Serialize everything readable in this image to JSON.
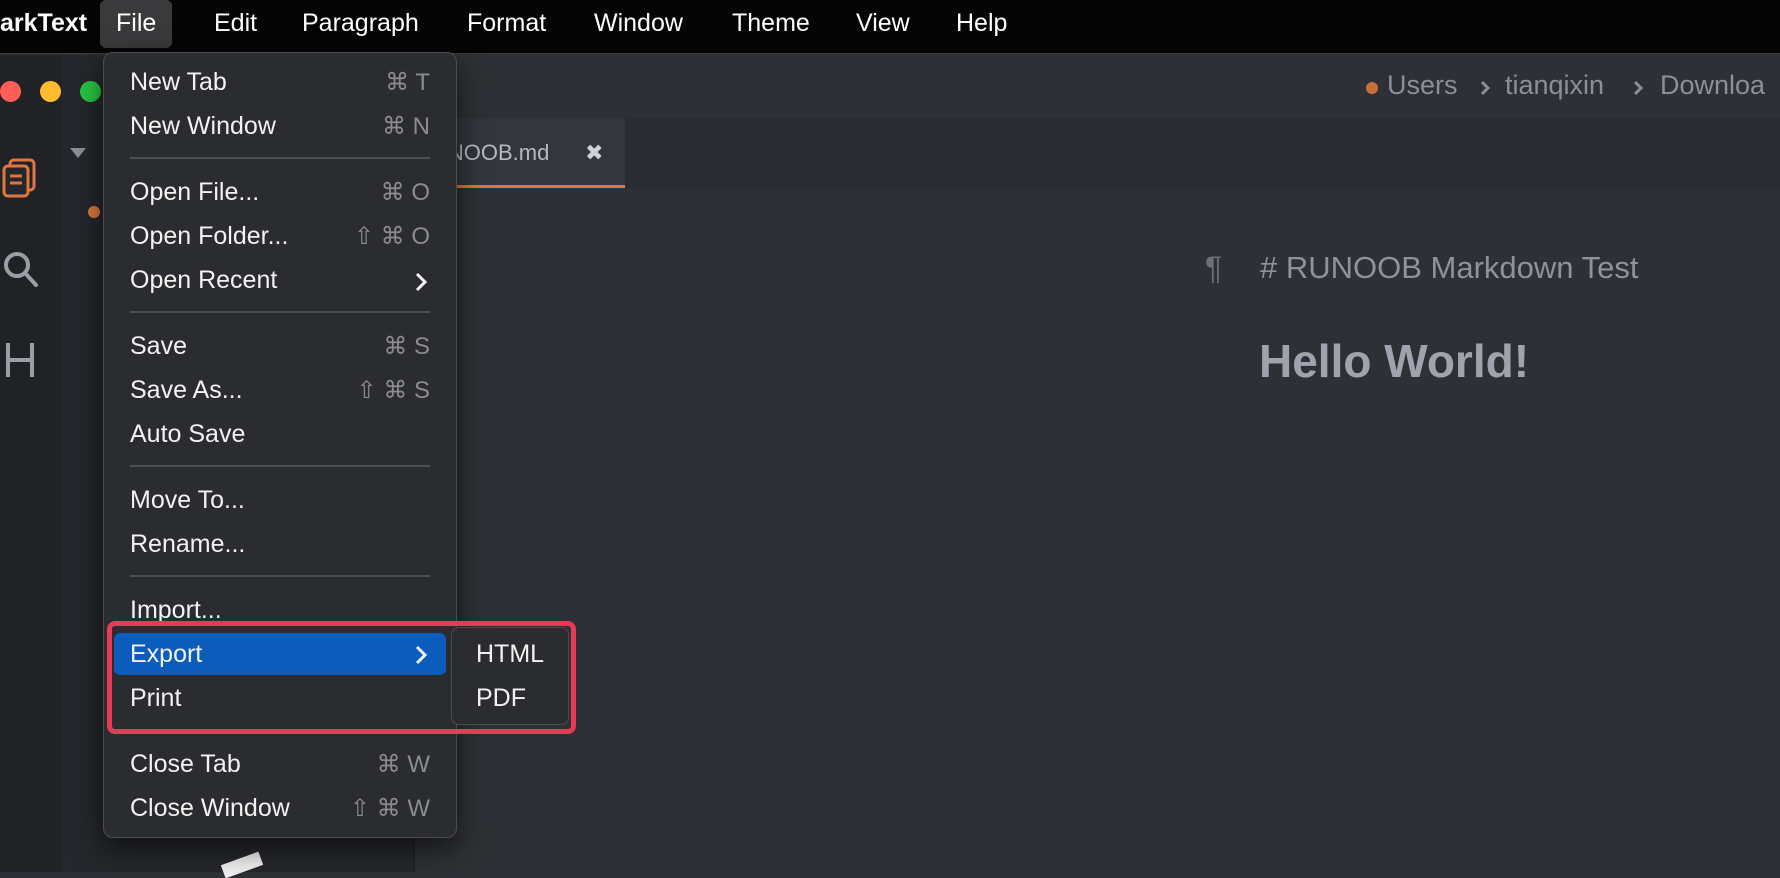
{
  "menubar": {
    "app_name": "arkText",
    "items": [
      "File",
      "Edit",
      "Paragraph",
      "Format",
      "Window",
      "Theme",
      "View",
      "Help"
    ]
  },
  "breadcrumb": [
    "Users",
    "tianqixin",
    "Downloa"
  ],
  "tab": {
    "label": "UNOOB.md",
    "close": "✖"
  },
  "editor": {
    "pilcrow": "¶",
    "heading_source": "# RUNOOB Markdown Test",
    "h2_text": "Hello World!"
  },
  "file_menu": {
    "new_tab": "New Tab",
    "new_tab_sc": "⌘ T",
    "new_window": "New Window",
    "new_window_sc": "⌘ N",
    "open_file": "Open File...",
    "open_file_sc": "⌘ O",
    "open_folder": "Open Folder...",
    "open_folder_sc": "⇧ ⌘ O",
    "open_recent": "Open Recent",
    "save": "Save",
    "save_sc": "⌘ S",
    "save_as": "Save As...",
    "save_as_sc": "⇧ ⌘ S",
    "auto_save": "Auto Save",
    "move_to": "Move To...",
    "rename": "Rename...",
    "import": "Import...",
    "export": "Export",
    "print": "Print",
    "close_tab": "Close Tab",
    "close_tab_sc": "⌘ W",
    "close_window": "Close Window",
    "close_window_sc": "⇧ ⌘ W"
  },
  "export_submenu": [
    "HTML",
    "PDF"
  ],
  "sidebar_icons": [
    "files-icon",
    "search-icon",
    "heading-icon"
  ],
  "colors": {
    "accent": "#e0763f",
    "highlight": "#0b5cbb",
    "annotation": "#e63a55"
  }
}
